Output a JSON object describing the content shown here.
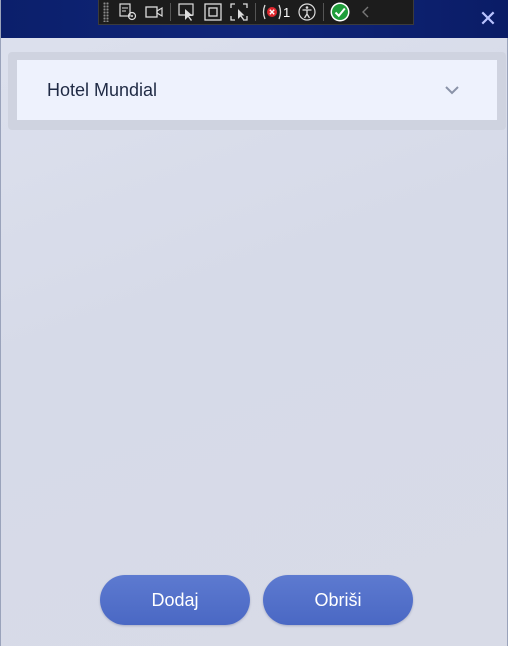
{
  "window": {
    "close_glyph": "✕"
  },
  "dev_toolbar": {
    "binding_failures_count": "1",
    "icons": [
      "live-visual-tree-icon",
      "video-record-icon",
      "select-element-icon",
      "display-layout-adorners-icon",
      "track-focus-icon",
      "binding-failures-icon",
      "accessibility-checker-icon",
      "check-accessibility-ok-icon",
      "collapse-toolbar-icon"
    ]
  },
  "combo": {
    "selected_value": "Hotel Mundial"
  },
  "buttons": {
    "add_label": "Dodaj",
    "delete_label": "Obriši"
  },
  "colors": {
    "titlebar": "#0b1f6b",
    "accent_button": "#4f6dc8",
    "background": "#d8dce9"
  }
}
